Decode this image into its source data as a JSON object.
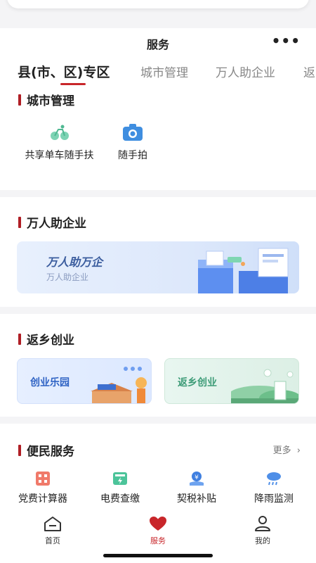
{
  "header": {
    "title": "服务",
    "more_label": "•••"
  },
  "tabs": [
    {
      "label": "县(市、区)专区",
      "active": true
    },
    {
      "label": "城市管理"
    },
    {
      "label": "万人助企业"
    },
    {
      "label": "返"
    }
  ],
  "city": {
    "title": "城市管理",
    "items": [
      {
        "label": "共享单车随手扶",
        "icon": "bicycle-icon"
      },
      {
        "label": "随手拍",
        "icon": "camera-icon"
      }
    ]
  },
  "enterprise": {
    "title": "万人助企业",
    "banner_title": "万人助万企",
    "banner_sub": "万人助企业"
  },
  "hometown": {
    "title": "返乡创业",
    "cards": [
      {
        "label": "创业乐园"
      },
      {
        "label": "返乡创业"
      }
    ]
  },
  "services": {
    "title": "便民服务",
    "more_label": "更多",
    "items": [
      {
        "label": "党费计算器",
        "icon": "calculator-icon"
      },
      {
        "label": "电费查缴",
        "icon": "electric-meter-icon"
      },
      {
        "label": "契税补贴",
        "icon": "subsidy-icon"
      },
      {
        "label": "降雨监测",
        "icon": "rain-cloud-icon"
      }
    ]
  },
  "tabbar": [
    {
      "label": "首页",
      "icon": "home-icon"
    },
    {
      "label": "服务",
      "icon": "heart-icon",
      "active": true
    },
    {
      "label": "我的",
      "icon": "user-icon"
    }
  ],
  "colors": {
    "accent": "#c8262a",
    "title_bar": "#b01e25"
  }
}
